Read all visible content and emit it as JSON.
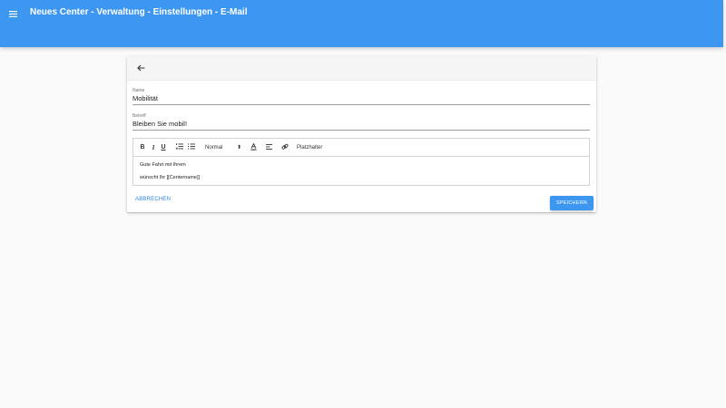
{
  "header": {
    "title": "Neues Center - Verwaltung - Einstellungen - E-Mail",
    "bar_color": "#3d97f1"
  },
  "form": {
    "name": {
      "label": "Name",
      "value": "Mobilität"
    },
    "subject": {
      "label": "Betreff",
      "value": "Bleiben Sie mobil!"
    }
  },
  "editor": {
    "toolbar": {
      "bold": "B",
      "italic": "I",
      "underline": "U",
      "size_selected": "Normal",
      "size_arrows": "⬍",
      "placeholder": "Platzhalter"
    },
    "content": {
      "line1": "Gute Fahrt mit Ihrem",
      "line2": "wünscht Ihr [[Centername]]"
    }
  },
  "actions": {
    "cancel_label": "ABBRECHEN",
    "save_label": "SPEICHERN",
    "accent_color": "#2f86e0"
  }
}
